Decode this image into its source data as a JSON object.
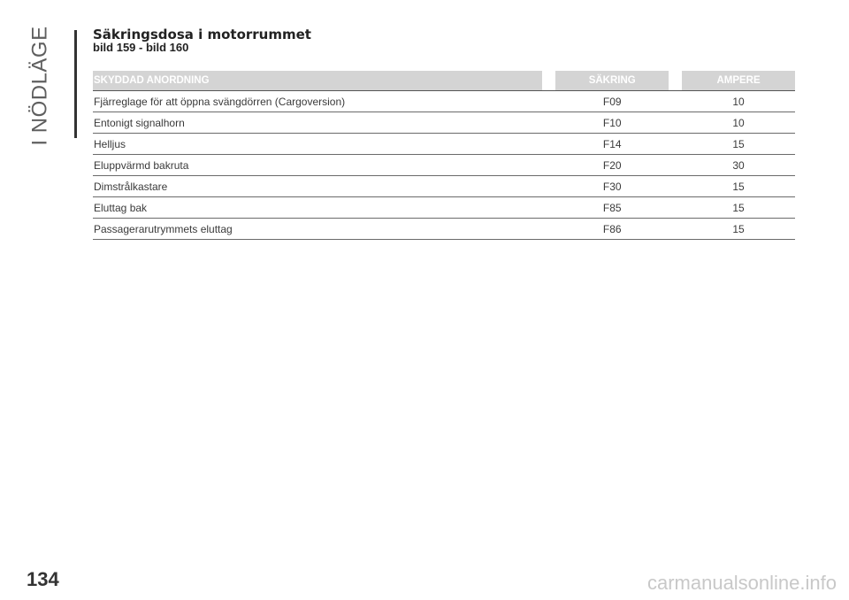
{
  "section_label": "I NÖDLÄGE",
  "title": "Säkringsdosa i motorrummet",
  "subtitle": "bild 159 - bild 160",
  "table": {
    "headers": {
      "device": "SKYDDAD ANORDNING",
      "fuse": "SÄKRING",
      "ampere": "AMPERE"
    },
    "rows": [
      {
        "device": "Fjärreglage för att öppna svängdörren (Cargoversion)",
        "fuse": "F09",
        "ampere": "10"
      },
      {
        "device": "Entonigt signalhorn",
        "fuse": "F10",
        "ampere": "10"
      },
      {
        "device": "Helljus",
        "fuse": "F14",
        "ampere": "15"
      },
      {
        "device": "Eluppvärmd bakruta",
        "fuse": "F20",
        "ampere": "30"
      },
      {
        "device": "Dimstrålkastare",
        "fuse": "F30",
        "ampere": "15"
      },
      {
        "device": "Eluttag bak",
        "fuse": "F85",
        "ampere": "15"
      },
      {
        "device": "Passagerarutrymmets eluttag",
        "fuse": "F86",
        "ampere": "15"
      }
    ]
  },
  "page_number": "134",
  "watermark": "carmanualsonline.info"
}
